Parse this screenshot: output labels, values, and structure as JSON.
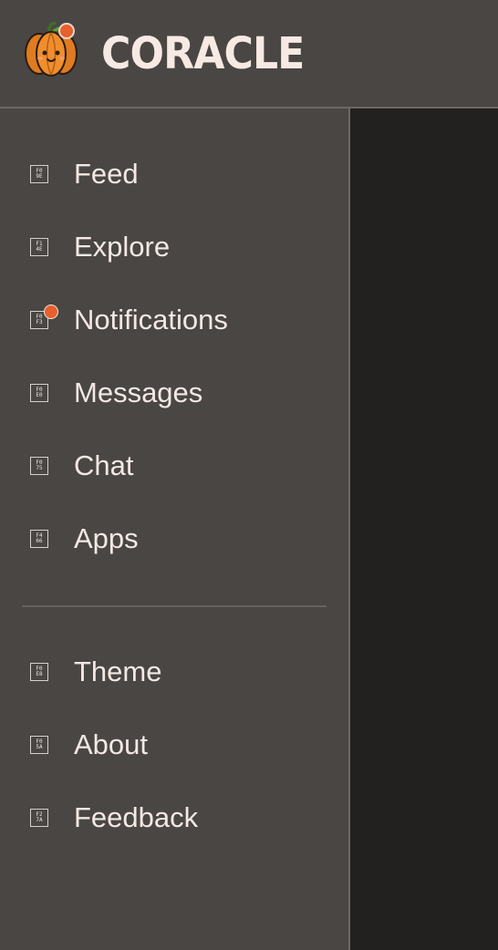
{
  "header": {
    "brand": "CORACLE",
    "logo_icon": "pumpkin-icon",
    "accent_color": "#e7602b"
  },
  "sidebar": {
    "primary_items": [
      {
        "label": "Feed",
        "icon": "feed-icon",
        "glyph": [
          "F0",
          "9E"
        ]
      },
      {
        "label": "Explore",
        "icon": "explore-icon",
        "glyph": [
          "F1",
          "4E"
        ]
      },
      {
        "label": "Notifications",
        "icon": "notifications-icon",
        "glyph": [
          "F0",
          "F3"
        ],
        "has_badge": true
      },
      {
        "label": "Messages",
        "icon": "messages-icon",
        "glyph": [
          "F0",
          "E0"
        ]
      },
      {
        "label": "Chat",
        "icon": "chat-icon",
        "glyph": [
          "F0",
          "75"
        ]
      },
      {
        "label": "Apps",
        "icon": "apps-icon",
        "glyph": [
          "F4",
          "66"
        ]
      }
    ],
    "secondary_items": [
      {
        "label": "Theme",
        "icon": "theme-icon",
        "glyph": [
          "F0",
          "E8"
        ]
      },
      {
        "label": "About",
        "icon": "about-icon",
        "glyph": [
          "F0",
          "5A"
        ]
      },
      {
        "label": "Feedback",
        "icon": "feedback-icon",
        "glyph": [
          "F2",
          "7A"
        ]
      }
    ]
  }
}
